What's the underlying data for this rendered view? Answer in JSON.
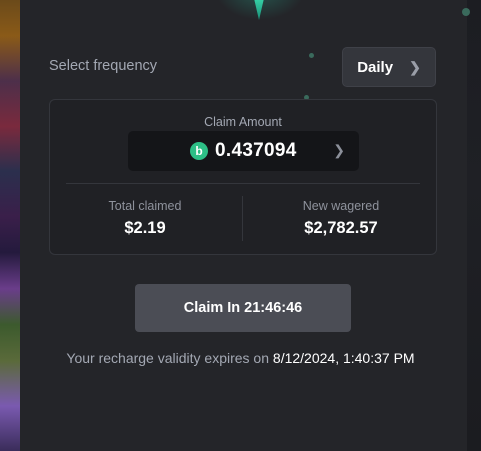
{
  "frequency": {
    "label": "Select frequency",
    "selected": "Daily"
  },
  "claim": {
    "title": "Claim Amount",
    "coin_icon": "bc-coin-icon",
    "coin_glyph": "b",
    "amount": "0.437094"
  },
  "stats": {
    "total_claimed_label": "Total claimed",
    "total_claimed_value": "$2.19",
    "new_wagered_label": "New wagered",
    "new_wagered_value": "$2,782.57"
  },
  "claim_button": {
    "label": "Claim In 21:46:46"
  },
  "expiry": {
    "prefix": "Your recharge validity expires on ",
    "date": "8/12/2024, 1:40:37 PM"
  },
  "colors": {
    "accent": "#2dbf86",
    "panel": "#242529",
    "button": "#4b4d55"
  }
}
